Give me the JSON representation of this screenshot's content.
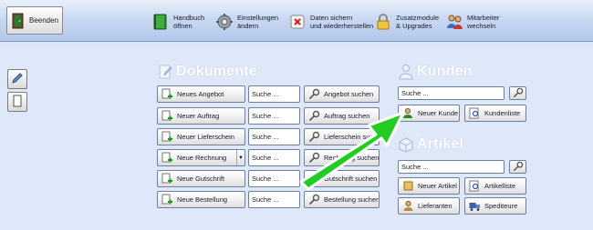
{
  "toolbar": {
    "exit_label": "Beenden",
    "items": [
      {
        "icon": "book-icon",
        "line1": "Handbuch",
        "line2": "öffnen"
      },
      {
        "icon": "gear-icon",
        "line1": "Einstellungen",
        "line2": "ändern"
      },
      {
        "icon": "backup-icon",
        "line1": "Daten sichern",
        "line2": "und wiederherstellen"
      },
      {
        "icon": "lock-icon",
        "line1": "Zusatzmodule",
        "line2": "& Upgrades"
      },
      {
        "icon": "users-icon",
        "line1": "Mitarbeiter",
        "line2": "wechseln"
      }
    ]
  },
  "sections": {
    "dokumente": "Dokumente",
    "kunden": "Kunden",
    "artikel": "Artikel"
  },
  "dokumente": {
    "rows": [
      {
        "new": "Neues Angebot",
        "field": "Suche ...",
        "search": "Angebot suchen"
      },
      {
        "new": "Neuer Auftrag",
        "field": "Suche ...",
        "search": "Auftrag suchen"
      },
      {
        "new": "Neuer Lieferschein",
        "field": "Suche ...",
        "search": "Lieferschein suchen"
      },
      {
        "new": "Neue Rechnung",
        "field": "Suche ...",
        "search": "Rechnung suchen"
      },
      {
        "new": "Neue Gutschrift",
        "field": "Suche ...",
        "search": "Gutschrift suchen"
      },
      {
        "new": "Neue Bestellung",
        "field": "Suche ...",
        "search": "Bestellung suchen"
      }
    ]
  },
  "kunden": {
    "search_value": "Suche ...",
    "new_label": "Neuer Kunde",
    "list_label": "Kundenliste"
  },
  "artikel": {
    "search_value": "Suche ...",
    "new_label": "Neuer Artikel",
    "list_label": "Artikelliste",
    "supplier_label": "Lieferanten",
    "carrier_label": "Spediteure"
  },
  "colors": {
    "accent_arrow": "#22cc22",
    "header_bg": "#c9d9f2",
    "body_bg": "#dfe8f8"
  }
}
